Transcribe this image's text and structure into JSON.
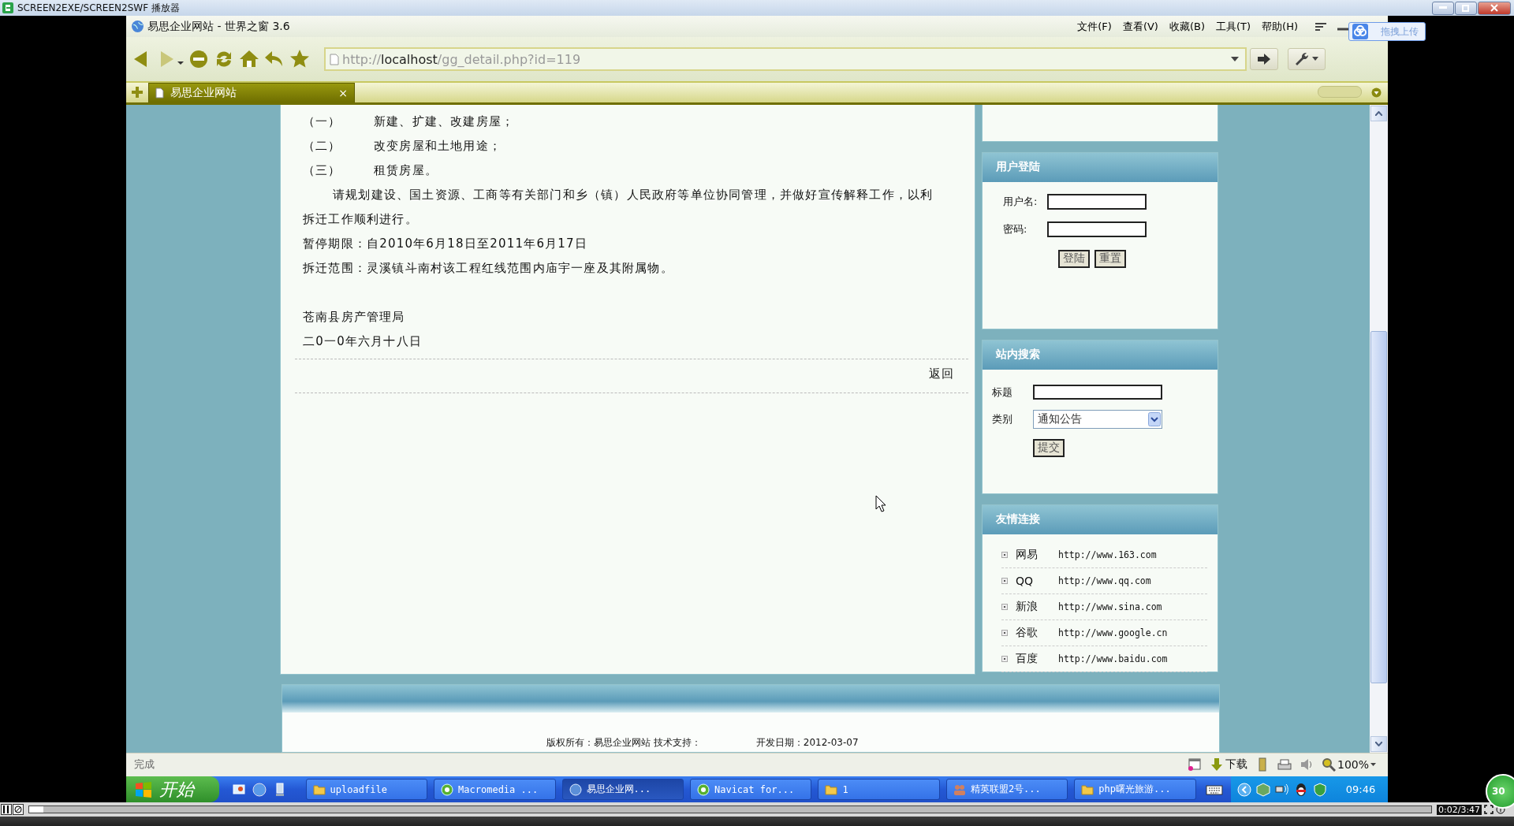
{
  "player": {
    "title": "SCREEN2EXE/SCREEN2SWF 播放器",
    "time": "0:02/3:47",
    "progress": {
      "level": 0.01
    },
    "badge": "30"
  },
  "browser": {
    "title": "易思企业网站 - 世界之窗 3.6",
    "menu": [
      "文件(F)",
      "查看(V)",
      "收藏(B)",
      "工具(T)",
      "帮助(H)"
    ],
    "upload_button": "拖拽上传",
    "address": {
      "scheme": "http://",
      "host": "localhost",
      "path": "/gg_detail.php?id=119"
    },
    "tabs": [
      {
        "label": "易思企业网站",
        "close": "×",
        "selected": true
      }
    ]
  },
  "article": {
    "items": [
      {
        "marker": "（一）",
        "text": "新建、扩建、改建房屋；"
      },
      {
        "marker": "（二）",
        "text": "改变房屋和土地用途；"
      },
      {
        "marker": "（三）",
        "text": "租赁房屋。"
      }
    ],
    "paragraph": "请规划建设、国土资源、工商等有关部门和乡（镇）人民政府等单位协同管理，并做好宣传解释工作，以利拆迁工作顺利进行。",
    "lines": [
      "暂停期限：自2010年6月18日至2011年6月17日",
      "拆迁范围：灵溪镇斗南村该工程红线范围内庙宇一座及其附属物。"
    ],
    "signature": [
      "苍南县房产管理局",
      "二0一0年六月十八日"
    ],
    "back_link": "返回"
  },
  "sidebar": {
    "login": {
      "title": "用户登陆",
      "fields": [
        {
          "label": "用户名:"
        },
        {
          "label": "密码:"
        }
      ],
      "buttons": [
        "登陆",
        "重置"
      ]
    },
    "search": {
      "title": "站内搜索",
      "field": {
        "label": "标题"
      },
      "category": {
        "label": "类别",
        "value": "通知公告"
      },
      "button": "提交"
    },
    "links": {
      "title": "友情连接",
      "items": [
        {
          "name": "网易",
          "url": "http://www.163.com"
        },
        {
          "name": "QQ",
          "url": "http://www.qq.com"
        },
        {
          "name": "新浪",
          "url": "http://www.sina.com"
        },
        {
          "name": "谷歌",
          "url": "http://www.google.cn"
        },
        {
          "name": "百度",
          "url": "http://www.baidu.com"
        }
      ]
    }
  },
  "footer": {
    "lines": [
      "版权所有：易思企业网站 技术支持：",
      "开发日期：2012-03-07"
    ]
  },
  "status_bar": {
    "text": "完成",
    "download": "下载",
    "zoom": "100%"
  },
  "taskbar": {
    "start": "开始",
    "tasks": [
      {
        "label": "uploadfile",
        "kind": "folder",
        "selected": false
      },
      {
        "label": "Macromedia ...",
        "kind": "app",
        "selected": false
      },
      {
        "label": "易思企业网...",
        "kind": "globe",
        "selected": true
      },
      {
        "label": "Navicat for...",
        "kind": "app",
        "selected": false
      },
      {
        "label": "1",
        "kind": "folder",
        "selected": false
      },
      {
        "label": "精英联盟2号...",
        "kind": "people",
        "selected": false
      },
      {
        "label": "php曙光旅游...",
        "kind": "folder",
        "selected": false
      }
    ],
    "clock": "09:46"
  }
}
